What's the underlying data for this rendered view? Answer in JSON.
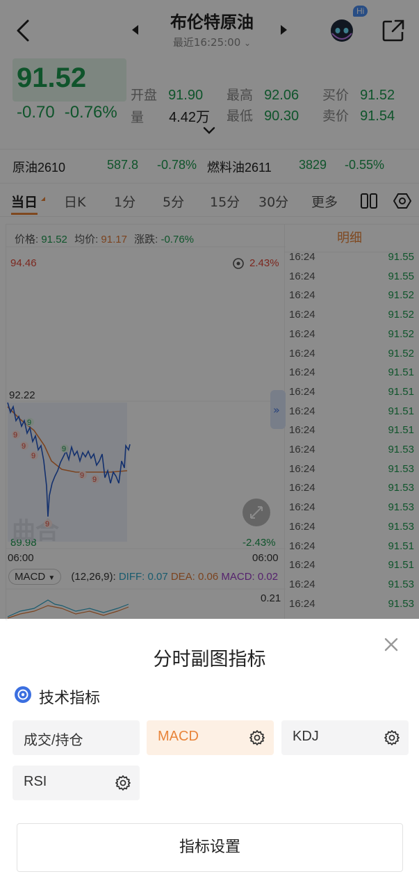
{
  "header": {
    "title": "布伦特原油",
    "subtitle": "最近16:25:00",
    "badge": "Hi"
  },
  "quote": {
    "price": "91.52",
    "change": "-0.70",
    "change_pct": "-0.76%",
    "open_label": "开盘",
    "open_value": "91.90",
    "high_label": "最高",
    "high_value": "92.06",
    "bid_label": "买价",
    "bid_value": "91.52",
    "volume_label": "量",
    "volume_value": "4.42万",
    "low_label": "最低",
    "low_value": "90.30",
    "ask_label": "卖价",
    "ask_value": "91.54"
  },
  "related": [
    {
      "name": "原油2610",
      "price": "587.8",
      "pct": "-0.78%"
    },
    {
      "name": "燃料油2611",
      "price": "3829",
      "pct": "-0.55%"
    }
  ],
  "tabs": [
    "当日",
    "日K",
    "1分",
    "5分",
    "15分",
    "30分",
    "更多"
  ],
  "chart": {
    "info_price_label": "价格:",
    "info_price": "91.52",
    "info_avg_label": "均价:",
    "info_avg": "91.17",
    "info_chg_label": "涨跌:",
    "info_chg": "-0.76%",
    "y_top": "94.46",
    "y_mid": "92.22",
    "y_bottom": "89.98",
    "pct_top": "2.43%",
    "pct_bottom": "-2.43%",
    "x_left": "06:00",
    "x_right": "06:00",
    "watermark": "曲合",
    "macd_select": "MACD",
    "macd_params": "(12,26,9):",
    "diff": "DIFF: 0.07",
    "dea": "DEA: 0.06",
    "macd": "MACD: 0.02",
    "macd_top": "0.21",
    "colors": {
      "price_line": "#2458c6",
      "avg_line": "#e07b39",
      "up": "#e2493a",
      "down": "#1c9a4f"
    }
  },
  "detail": {
    "header": "明细",
    "rows": [
      {
        "time": "16:24",
        "price": "91.55"
      },
      {
        "time": "16:24",
        "price": "91.55"
      },
      {
        "time": "16:24",
        "price": "91.52"
      },
      {
        "time": "16:24",
        "price": "91.52"
      },
      {
        "time": "16:24",
        "price": "91.52"
      },
      {
        "time": "16:24",
        "price": "91.52"
      },
      {
        "time": "16:24",
        "price": "91.51"
      },
      {
        "time": "16:24",
        "price": "91.51"
      },
      {
        "time": "16:24",
        "price": "91.51"
      },
      {
        "time": "16:24",
        "price": "91.51"
      },
      {
        "time": "16:24",
        "price": "91.53"
      },
      {
        "time": "16:24",
        "price": "91.53"
      },
      {
        "time": "16:24",
        "price": "91.53"
      },
      {
        "time": "16:24",
        "price": "91.53"
      },
      {
        "time": "16:24",
        "price": "91.53"
      },
      {
        "time": "16:24",
        "price": "91.51"
      },
      {
        "time": "16:24",
        "price": "91.51"
      },
      {
        "time": "16:24",
        "price": "91.53"
      },
      {
        "time": "16:24",
        "price": "91.53"
      }
    ]
  },
  "sheet": {
    "title": "分时副图指标",
    "section": "技术指标",
    "options": [
      {
        "label": "成交/持仓",
        "selected": false,
        "has_gear": false
      },
      {
        "label": "MACD",
        "selected": true,
        "has_gear": true
      },
      {
        "label": "KDJ",
        "selected": false,
        "has_gear": true
      },
      {
        "label": "RSI",
        "selected": false,
        "has_gear": true
      }
    ],
    "settings_button": "指标设置",
    "accent": "#e8843a"
  }
}
